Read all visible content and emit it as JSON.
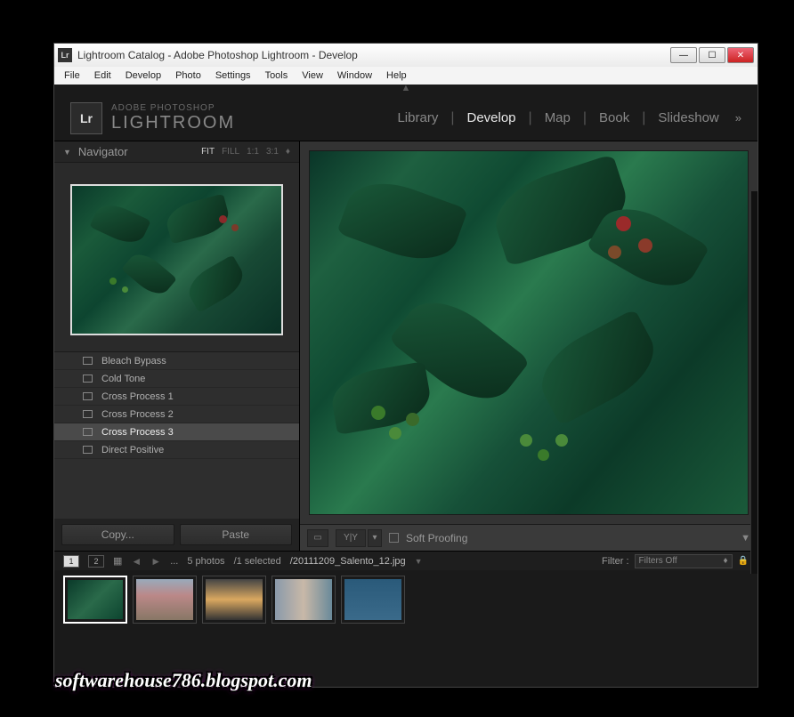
{
  "titlebar": {
    "app_icon": "Lr",
    "title": "Lightroom   Catalog - Adobe Photoshop Lightroom - Develop"
  },
  "menubar": [
    "File",
    "Edit",
    "Develop",
    "Photo",
    "Settings",
    "Tools",
    "View",
    "Window",
    "Help"
  ],
  "identity": {
    "badge": "Lr",
    "brand_small": "ADOBE PHOTOSHOP",
    "brand_big": "LIGHTROOM"
  },
  "modules": {
    "items": [
      "Library",
      "Develop",
      "Map",
      "Book",
      "Slideshow"
    ],
    "active": "Develop",
    "more": "»"
  },
  "navigator": {
    "title": "Navigator",
    "zoom_options": [
      "FIT",
      "FILL",
      "1:1",
      "3:1"
    ],
    "zoom_active": "FIT",
    "zoom_extra": "♦"
  },
  "presets": [
    {
      "label": "Bleach Bypass",
      "selected": false
    },
    {
      "label": "Cold Tone",
      "selected": false
    },
    {
      "label": "Cross Process 1",
      "selected": false
    },
    {
      "label": "Cross Process 2",
      "selected": false
    },
    {
      "label": "Cross Process 3",
      "selected": true
    },
    {
      "label": "Direct Positive",
      "selected": false
    }
  ],
  "copy_paste": {
    "copy": "Copy...",
    "paste": "Paste"
  },
  "toolbar": {
    "loupe": "▭",
    "compare_y": "Y|Y",
    "soft_proof_label": "Soft Proofing"
  },
  "filmstrip_bar": {
    "screens": [
      "1",
      "2"
    ],
    "ellipsis": "...",
    "count": "5 photos",
    "selected": "/1 selected",
    "filename": "/20111209_Salento_12.jpg",
    "filter_label": "Filter :",
    "filter_value": "Filters Off"
  },
  "watermark": "softwarehouse786.blogspot.com"
}
